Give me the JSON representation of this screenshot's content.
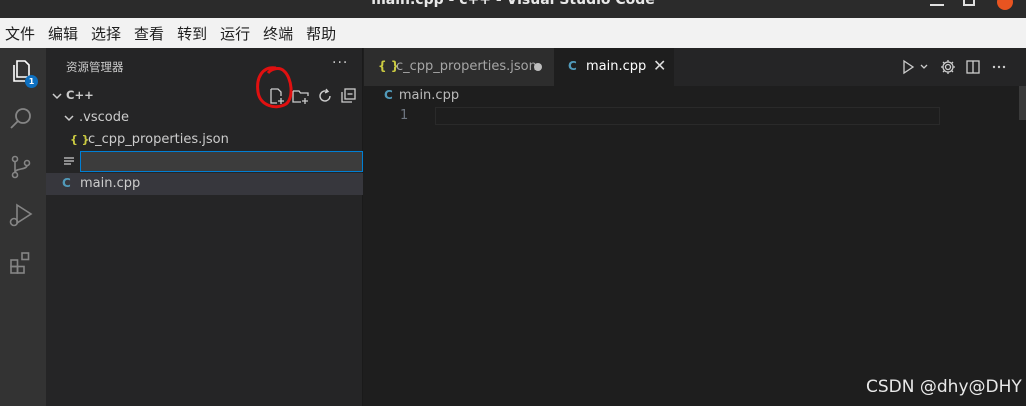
{
  "window": {
    "title": "main.cpp - c++ - Visual Studio Code"
  },
  "menubar": {
    "items": [
      "文件",
      "编辑",
      "选择",
      "查看",
      "转到",
      "运行",
      "终端",
      "帮助"
    ]
  },
  "activity": {
    "explorer_badge": "1"
  },
  "sidebar": {
    "title": "资源管理器",
    "more": "···",
    "folder": "C++",
    "tree": {
      "vscode_folder": ".vscode",
      "json_file": "c_cpp_properties.json",
      "json_icon": "{ }",
      "cpp_file": "main.cpp",
      "cpp_icon": "C"
    },
    "new_item_input": ""
  },
  "tabs": [
    {
      "label": "c_cpp_properties.json",
      "icon": "{ }"
    },
    {
      "label": "main.cpp",
      "icon": "C",
      "close": "✕"
    }
  ],
  "editor": {
    "breadcrumb": "main.cpp",
    "breadcrumb_icon": "C",
    "line_number": "1"
  },
  "watermark": "CSDN @dhy@DHY",
  "colors": {
    "accent": "#007fd4",
    "annotation": "#e01010",
    "json_icon": "#cbcb41",
    "cpp_icon": "#519aba"
  }
}
